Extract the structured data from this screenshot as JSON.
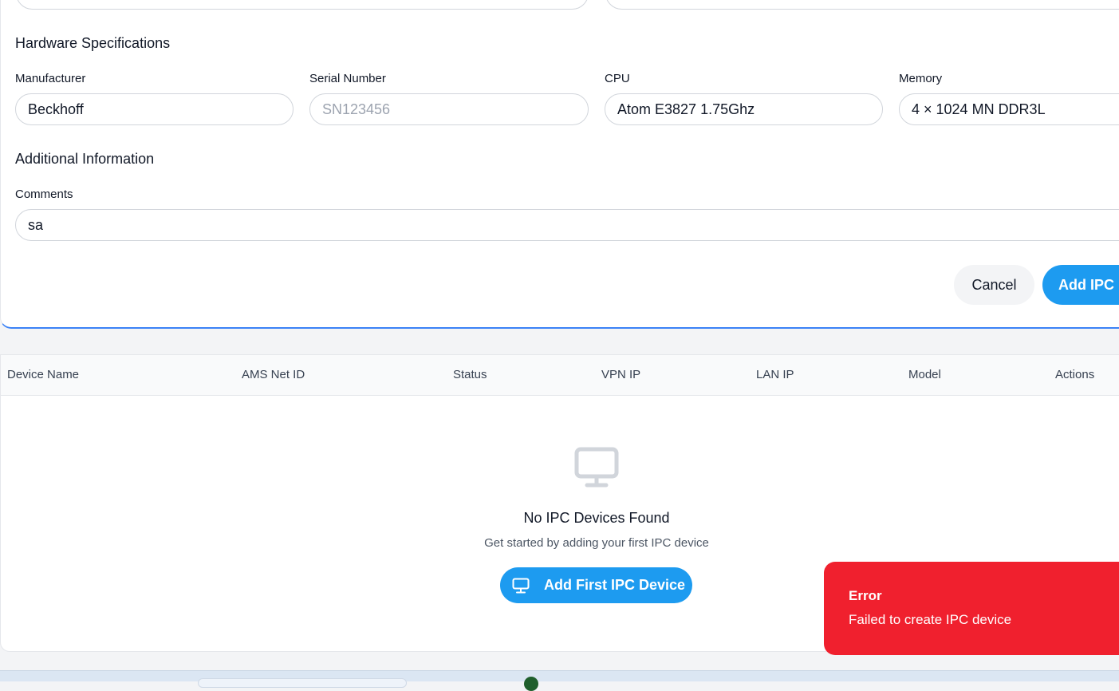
{
  "hardware": {
    "section_title": "Hardware Specifications",
    "manufacturer": {
      "label": "Manufacturer",
      "value": "Beckhoff"
    },
    "serial_number": {
      "label": "Serial Number",
      "placeholder": "SN123456"
    },
    "cpu": {
      "label": "CPU",
      "value": "Atom E3827 1.75Ghz"
    },
    "memory": {
      "label": "Memory",
      "value": "4 × 1024 MN DDR3L"
    }
  },
  "additional": {
    "section_title": "Additional Information",
    "comments": {
      "label": "Comments",
      "value": "sa"
    }
  },
  "form_actions": {
    "cancel_label": "Cancel",
    "submit_label": "Add IPC Device"
  },
  "table": {
    "columns": [
      "Device Name",
      "AMS Net ID",
      "Status",
      "VPN IP",
      "LAN IP",
      "Model",
      "Actions"
    ]
  },
  "empty_state": {
    "icon": "monitor-icon",
    "title": "No IPC Devices Found",
    "subtitle": "Get started by adding your first IPC device",
    "button_label": "Add First IPC Device"
  },
  "toast": {
    "title": "Error",
    "message": "Failed to create IPC device",
    "color": "#f0202e"
  },
  "colors": {
    "primary": "#1d9bf0",
    "focus_border": "#3b82f6"
  }
}
